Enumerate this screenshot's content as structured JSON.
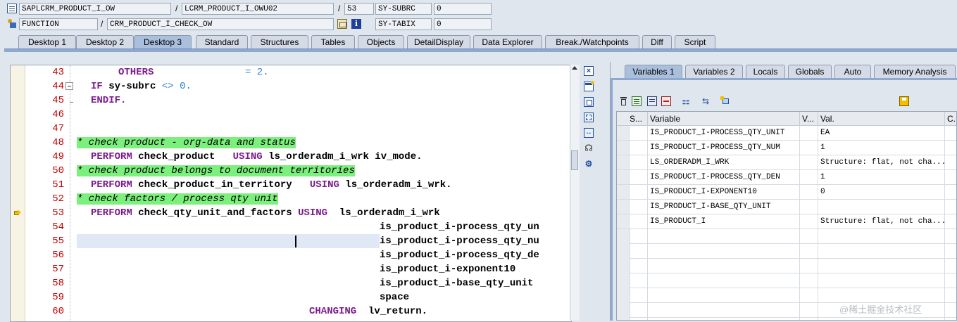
{
  "header": {
    "row1": {
      "program": "SAPLCRM_PRODUCT_I_OW",
      "include": "LCRM_PRODUCT_I_OWU02",
      "line": "53",
      "sysfield": "SY-SUBRC",
      "sysvalue": "0"
    },
    "row2": {
      "type": "FUNCTION",
      "name": "CRM_PRODUCT_I_CHECK_OW",
      "sysfield": "SY-TABIX",
      "sysvalue": "0"
    },
    "separator": "/"
  },
  "tabs": [
    "Desktop 1",
    "Desktop 2",
    "Desktop 3",
    "Standard",
    "Structures",
    "Tables",
    "Objects",
    "DetailDisplay",
    "Data Explorer",
    "Break./Watchpoints",
    "Diff",
    "Script"
  ],
  "active_tab": "Desktop 3",
  "editor": {
    "current_line": "53",
    "lines": [
      {
        "num": "43",
        "text": "    OTHERS            = 2."
      },
      {
        "num": "44",
        "text": "IF sy-subrc <> 0."
      },
      {
        "num": "45",
        "text": "ENDIF."
      },
      {
        "num": "46",
        "text": ""
      },
      {
        "num": "47",
        "text": ""
      },
      {
        "num": "48",
        "text": "* check product - org-data and status"
      },
      {
        "num": "49",
        "text": "  PERFORM check_product   USING ls_orderadm_i_wrk iv_mode."
      },
      {
        "num": "50",
        "text": "* check product belongs to document territories"
      },
      {
        "num": "51",
        "text": "  PERFORM check_product_in_territory   USING ls_orderadm_i_wrk."
      },
      {
        "num": "52",
        "text": "* check factors / process qty unit"
      },
      {
        "num": "53",
        "text": "  PERFORM check_qty_unit_and_factors USING ls_orderadm_i_wrk"
      },
      {
        "num": "54",
        "text": "is_product_i-process_qty_un"
      },
      {
        "num": "55",
        "text": "is_product_i-process_qty_nu"
      },
      {
        "num": "56",
        "text": "is_product_i-process_qty_de"
      },
      {
        "num": "57",
        "text": "is_product_i-exponent10"
      },
      {
        "num": "58",
        "text": "is_product_i-base_qty_unit"
      },
      {
        "num": "59",
        "text": "space"
      },
      {
        "num": "60",
        "text": "lv_return."
      }
    ],
    "kw_others": "OTHERS",
    "eq2": "= 2.",
    "kw_if": "IF",
    "sysubrc": "sy-subrc",
    "ne": "<>",
    "zero": "0.",
    "kw_endif": "ENDIF.",
    "cmt48": "* check product - org-data and status",
    "cmt50": "* check product belongs to document territories",
    "cmt52": "* check factors / process qty unit",
    "kw_perform": "PERFORM",
    "kw_using": "USING",
    "kw_changing": "CHANGING",
    "l49a": "check_product",
    "l49b": "ls_orderadm_i_wrk iv_mode.",
    "l51a": "check_product_in_territory",
    "l51b": "ls_orderadm_i_wrk.",
    "l53a": "check_qty_unit_and_factors",
    "l53b": "ls_orderadm_i_wrk",
    "l54": "is_product_i-process_qty_un",
    "l55": "is_product_i-process_qty_nu",
    "l56": "is_product_i-process_qty_de",
    "l57": "is_product_i-exponent10",
    "l58": "is_product_i-base_qty_unit",
    "l59": "space",
    "l60": "lv_return."
  },
  "right_tabs": [
    "Variables 1",
    "Variables 2",
    "Locals",
    "Globals",
    "Auto",
    "Memory Analysis"
  ],
  "right_active_tab": "Variables 1",
  "grid": {
    "headers": [
      "S...",
      "Variable",
      "V...",
      "Val.",
      "C..."
    ],
    "rows": [
      {
        "variable": "IS_PRODUCT_I-PROCESS_QTY_UNIT",
        "value": "EA"
      },
      {
        "variable": "IS_PRODUCT_I-PROCESS_QTY_NUM",
        "value": "1"
      },
      {
        "variable": "LS_ORDERADM_I_WRK",
        "value": "Structure: flat, not cha..."
      },
      {
        "variable": "IS_PRODUCT_I-PROCESS_QTY_DEN",
        "value": "1"
      },
      {
        "variable": "IS_PRODUCT_I-EXPONENT10",
        "value": "0"
      },
      {
        "variable": "IS_PRODUCT_I-BASE_QTY_UNIT",
        "value": ""
      },
      {
        "variable": "IS_PRODUCT_I",
        "value": "Structure: flat, not cha..."
      }
    ]
  },
  "watermark": "@稀土掘金技术社区",
  "colors": {
    "accent": "#8ea8d0",
    "keyword": "#7b1a8c",
    "comment_bg": "#7cf07c",
    "line_number": "#c00000",
    "number": "#2a7fd4"
  }
}
